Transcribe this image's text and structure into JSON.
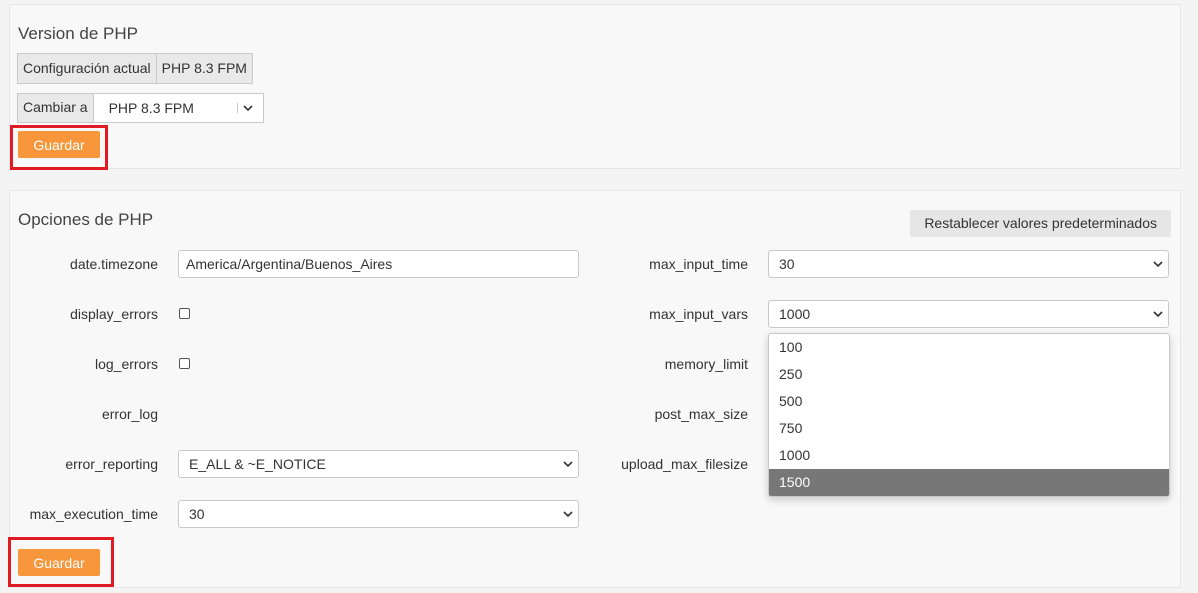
{
  "version_panel": {
    "title": "Version de PHP",
    "current_label": "Configuración actual",
    "current_value": "PHP 8.3 FPM",
    "change_label": "Cambiar a",
    "change_value": "PHP 8.3 FPM",
    "save_label": "Guardar"
  },
  "options_panel": {
    "title": "Opciones de PHP",
    "reset_label": "Restablecer valores predeterminados",
    "save_label": "Guardar",
    "left": {
      "date_timezone": {
        "label": "date.timezone",
        "value": "America/Argentina/Buenos_Aires"
      },
      "display_errors": {
        "label": "display_errors",
        "checked": false
      },
      "log_errors": {
        "label": "log_errors",
        "checked": false
      },
      "error_log": {
        "label": "error_log"
      },
      "error_reporting": {
        "label": "error_reporting",
        "value": "E_ALL & ~E_NOTICE"
      },
      "max_execution_time": {
        "label": "max_execution_time",
        "value": "30"
      }
    },
    "right": {
      "max_input_time": {
        "label": "max_input_time",
        "value": "30"
      },
      "max_input_vars": {
        "label": "max_input_vars",
        "value": "1000"
      },
      "memory_limit": {
        "label": "memory_limit"
      },
      "post_max_size": {
        "label": "post_max_size"
      },
      "upload_max_filesize": {
        "label": "upload_max_filesize"
      }
    },
    "max_input_vars_dropdown": {
      "options": [
        "100",
        "250",
        "500",
        "750",
        "1000",
        "1500"
      ],
      "highlighted": "1500"
    }
  },
  "colors": {
    "accent": "#f7963b",
    "highlight_box": "#e01b24",
    "dropdown_selected": "#777777"
  },
  "icons": {
    "select_arrow": "chevron-down-icon"
  }
}
